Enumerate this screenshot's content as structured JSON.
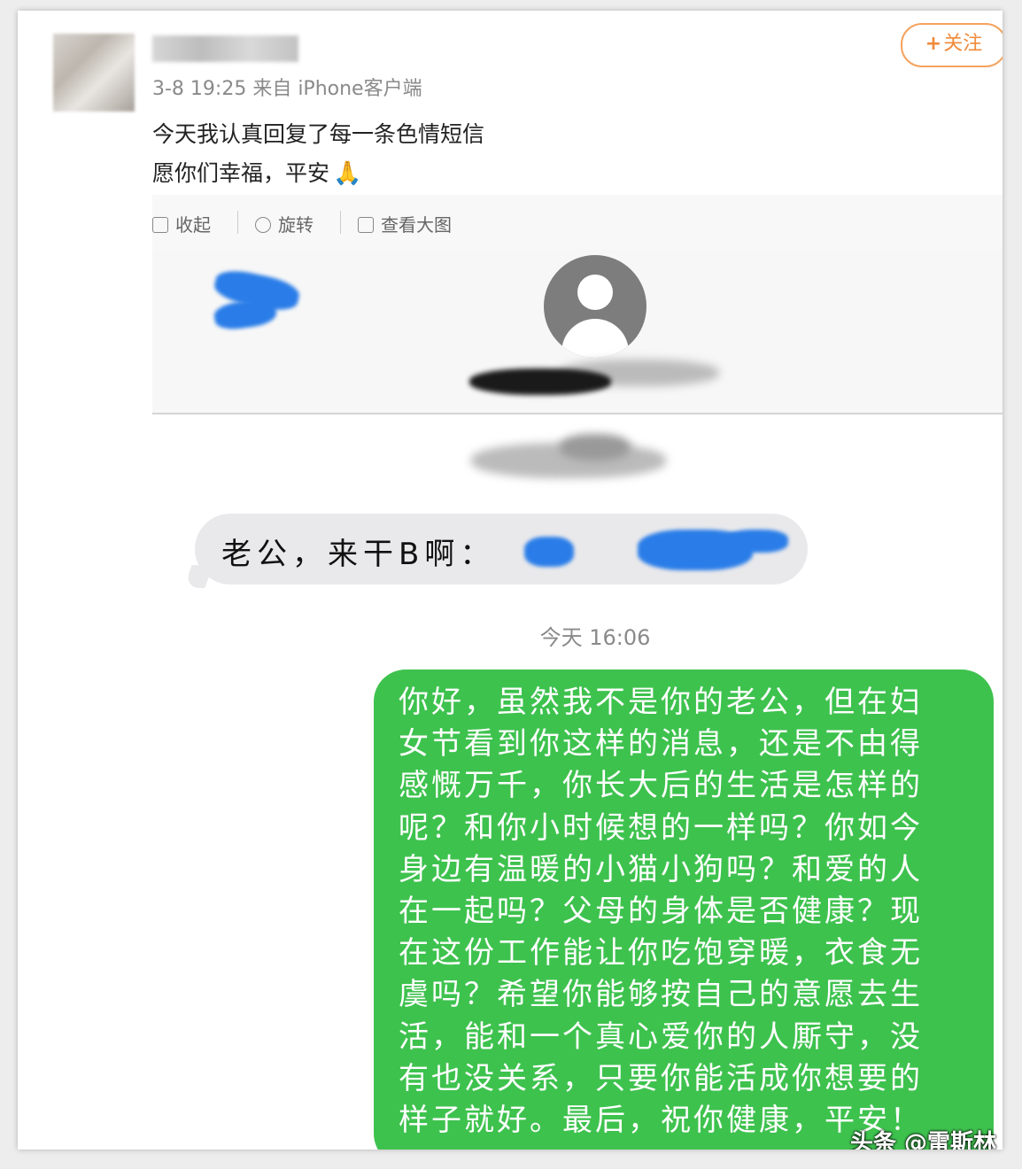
{
  "post": {
    "meta": "3-8 19:25 来自 iPhone客户端",
    "follow_label": "关注",
    "follow_plus": "+",
    "text_line1": "今天我认真回复了每一条色情短信",
    "text_line2": "愿你们幸福，平安",
    "emoji": "🙏"
  },
  "toolbar": {
    "collapse_label": "收起",
    "rotate_label": "旋转",
    "view_large_label": "查看大图"
  },
  "chat": {
    "incoming_text": "老公，来干B啊：",
    "timestamp": "今天 16:06",
    "outgoing_text": "你好，虽然我不是你的老公，但在妇\n女节看到你这样的消息，还是不由得\n感慨万千，你长大后的生活是怎样的\n呢？和你小时候想的一样吗？你如今\n身边有温暖的小猫小狗吗？和爱的人\n在一起吗？父母的身体是否健康？现\n在这份工作能让你吃饱穿暖，衣食无\n虞吗？希望你能够按自己的意愿去生\n活，能和一个真心爱你的人厮守，没\n有也没关系，只要你能活成你想要的\n样子就好。最后，祝你健康，平安！"
  },
  "watermark": "头条 @雷斯林",
  "colors": {
    "follow_orange": "#f08a3a",
    "outgoing_bubble": "#3ec24e",
    "incoming_bubble": "#e9e9eb",
    "smudge_blue": "#2a7de8"
  }
}
